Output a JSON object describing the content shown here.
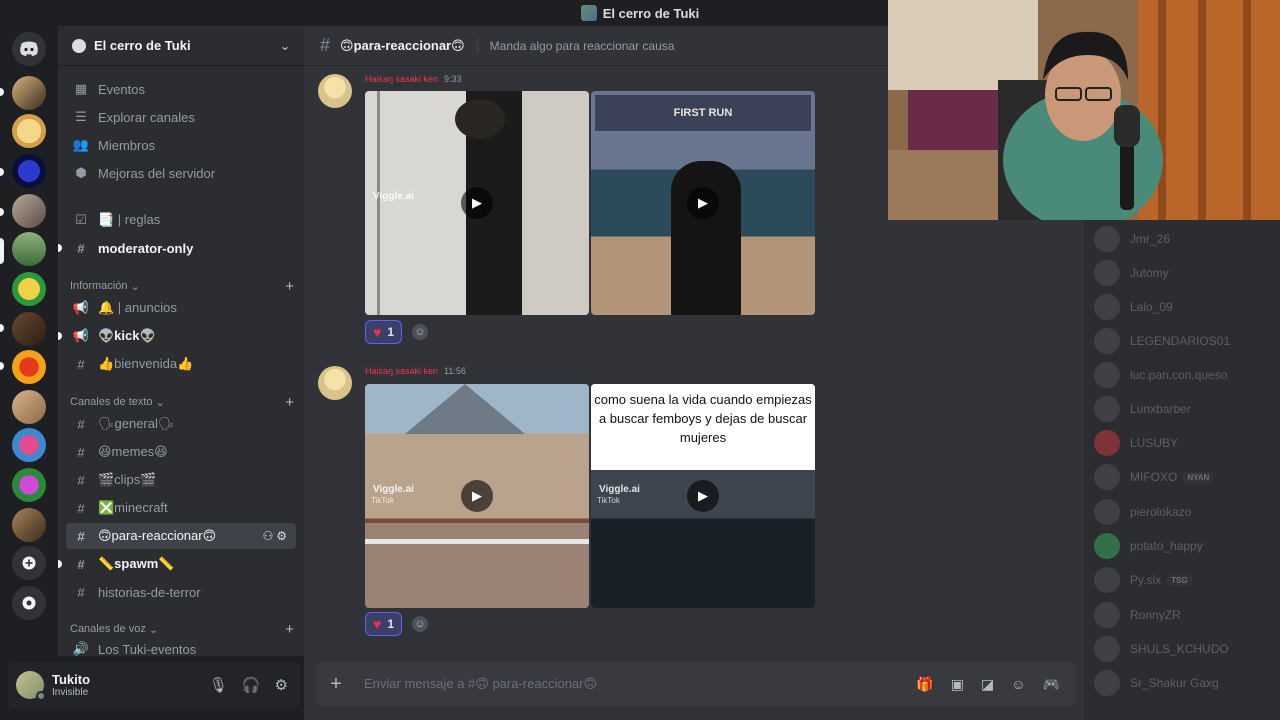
{
  "window": {
    "title": "El cerro de Tuki"
  },
  "server": {
    "name": "El cerro de Tuki",
    "nav": [
      "Eventos",
      "Explorar canales",
      "Miembros",
      "Mejoras del servidor"
    ]
  },
  "channels": {
    "top": [
      "📑 | reglas",
      "moderator-only"
    ],
    "cat_info": "Información",
    "info": [
      "🔔 | anuncios",
      "👽kick👽",
      "👍bienvenida👍"
    ],
    "cat_text": "Canales de texto",
    "text": [
      "🗣general🗣",
      "😆memes😆",
      "🎬clips🎬",
      "❎minecraft",
      "🙃para-reaccionar🙃",
      "📏spawm📏",
      "historias-de-terror"
    ],
    "cat_voice": "Canales de voz",
    "voice": [
      "Los Tuki-eventos"
    ]
  },
  "user": {
    "name": "Tukito",
    "status": "Invisible"
  },
  "header": {
    "channel": "🙃para-reaccionar🙃",
    "topic": "Manda algo para reaccionar causa"
  },
  "messages": [
    {
      "author": "Haisaŋ sasaki ken",
      "time": "9:33",
      "video1_watermark": "Viggle.ai",
      "banner": "FIRST RUN",
      "reaction_count": "1"
    },
    {
      "author": "Haisaŋ sasaki ken",
      "time": "11:56",
      "video1_watermark": "Viggle.ai",
      "video1_tiktok": "TikTok",
      "video2_watermark": "Viggle.ai",
      "video2_tiktok": "TikTok",
      "caption": "como suena la vida cuando empiezas a buscar femboys y dejas de buscar mujeres",
      "reaction_count": "1"
    }
  ],
  "composer": {
    "placeholder": "Enviar mensaje a #🙃 para-reaccionar🙃"
  },
  "members": [
    {
      "name": "Jmr_26"
    },
    {
      "name": "Jutomy"
    },
    {
      "name": "Lalo_09"
    },
    {
      "name": "LEGENDARIOS01"
    },
    {
      "name": "luc.pan.con.queso"
    },
    {
      "name": "Lunxbarber"
    },
    {
      "name": "LUSUBY"
    },
    {
      "name": "MIFOXO",
      "tag": "NYAN"
    },
    {
      "name": "pierolokazo"
    },
    {
      "name": "potato_happy"
    },
    {
      "name": "Py.six",
      "tag": "TSG"
    },
    {
      "name": "RonnyZR"
    },
    {
      "name": "SHULS_KCHUDO"
    },
    {
      "name": "Sr_Shakur Gaxg"
    }
  ],
  "colors": {
    "accent": "#5865f2",
    "author": "#e83a4b",
    "bg_main": "#313338",
    "bg_sidebar": "#2b2d31"
  }
}
